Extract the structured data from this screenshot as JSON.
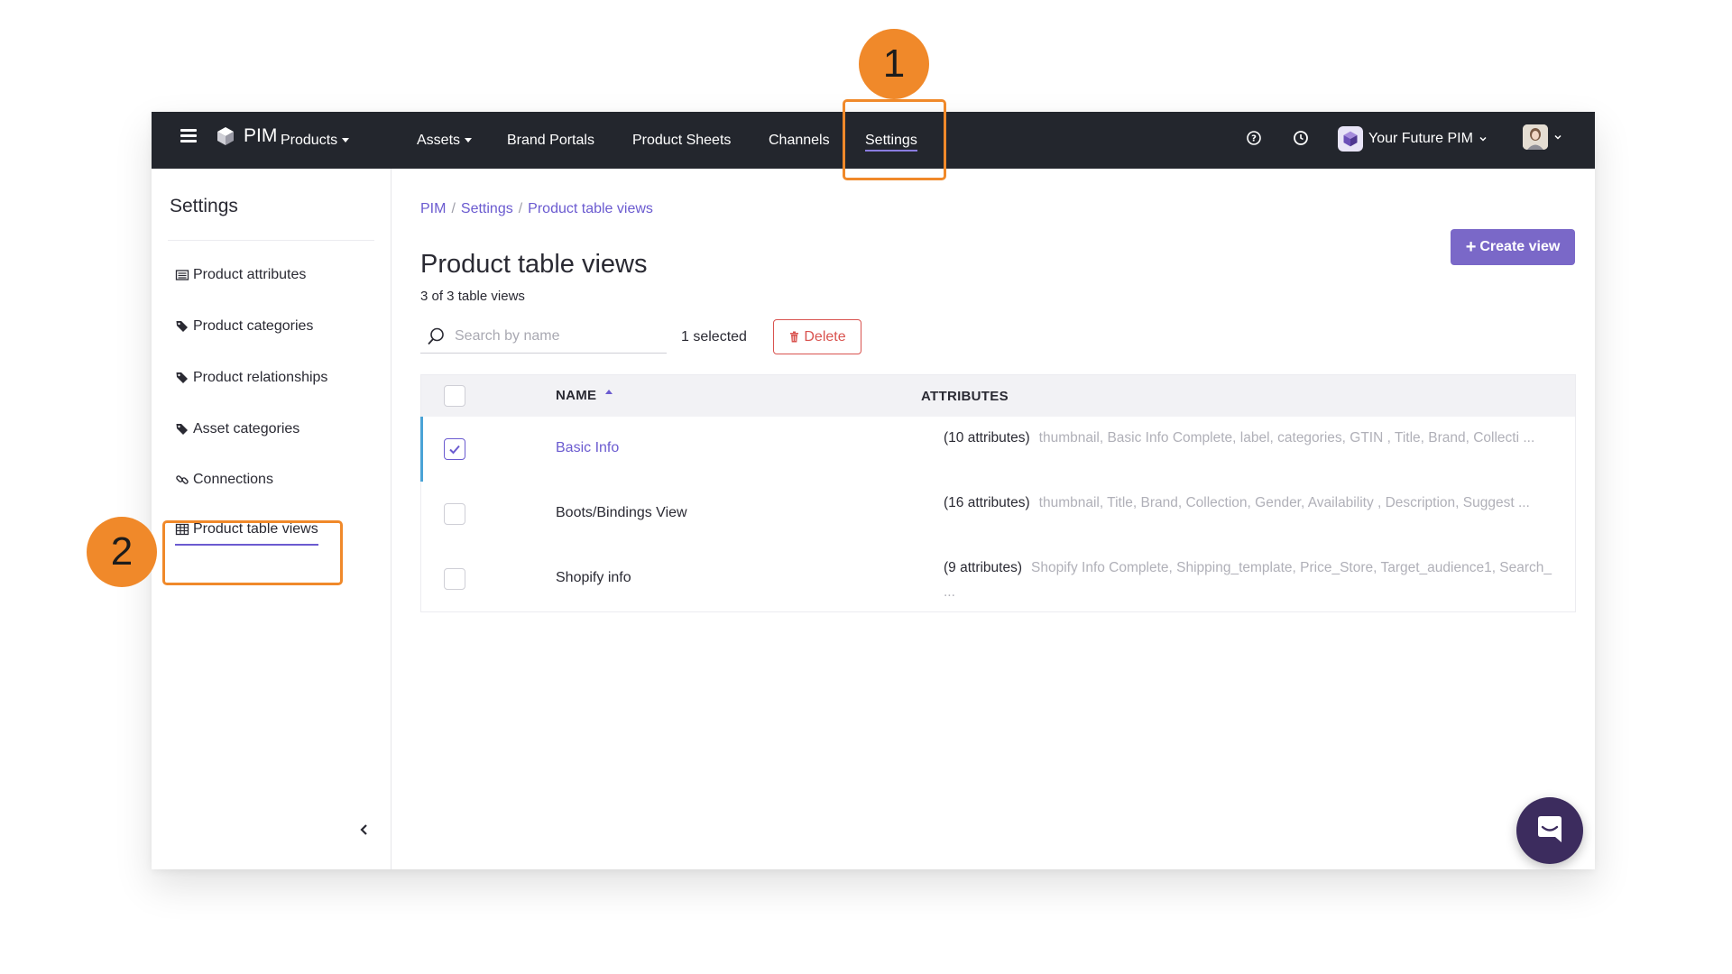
{
  "topbar": {
    "brand": "PIM",
    "nav": [
      {
        "label": "Products",
        "dropdown": true
      },
      {
        "label": "Assets",
        "dropdown": true
      },
      {
        "label": "Brand Portals",
        "dropdown": false
      },
      {
        "label": "Product Sheets",
        "dropdown": false
      },
      {
        "label": "Channels",
        "dropdown": false
      },
      {
        "label": "Settings",
        "dropdown": false,
        "active": true
      }
    ],
    "org_name": "Your Future PIM",
    "icons": [
      "menu-icon",
      "cube-logo-icon",
      "help-icon",
      "history-icon",
      "chevron-down-icon"
    ]
  },
  "sidebar": {
    "title": "Settings",
    "items": [
      {
        "label": "Product attributes",
        "icon": "list-icon"
      },
      {
        "label": "Product categories",
        "icon": "tags-icon"
      },
      {
        "label": "Product relationships",
        "icon": "tags-icon"
      },
      {
        "label": "Asset categories",
        "icon": "tags-icon"
      },
      {
        "label": "Connections",
        "icon": "link-icon"
      },
      {
        "label": "Product table views",
        "icon": "table-icon",
        "active": true
      }
    ]
  },
  "main": {
    "breadcrumb": [
      "PIM",
      "Settings",
      "Product table views"
    ],
    "title": "Product table views",
    "count_text": "3 of 3 table views",
    "create_label": "Create view",
    "search_placeholder": "Search by name",
    "selected_text": "1 selected",
    "delete_label": "Delete",
    "table": {
      "columns": [
        "NAME",
        "ATTRIBUTES"
      ],
      "rows": [
        {
          "name": "Basic Info",
          "checked": true,
          "attr_count": "(10 attributes)",
          "attrs": "thumbnail, Basic Info Complete, label, categories, GTIN , Title, Brand, Collecti ..."
        },
        {
          "name": "Boots/Bindings View",
          "checked": false,
          "attr_count": "(16 attributes)",
          "attrs": "thumbnail, Title, Brand, Collection, Gender, Availability , Description, Suggest ..."
        },
        {
          "name": "Shopify info",
          "checked": false,
          "attr_count": "(9 attributes)",
          "attrs": "Shopify Info Complete, Shipping_template, Price_Store, Target_audience1, Search_ ..."
        }
      ]
    }
  },
  "callouts": [
    "1",
    "2"
  ],
  "colors": {
    "topbar": "#23262d",
    "accent": "#6b5bd0",
    "callout": "#f0892a",
    "danger": "#d9534f",
    "chat": "#3c2c5e"
  }
}
